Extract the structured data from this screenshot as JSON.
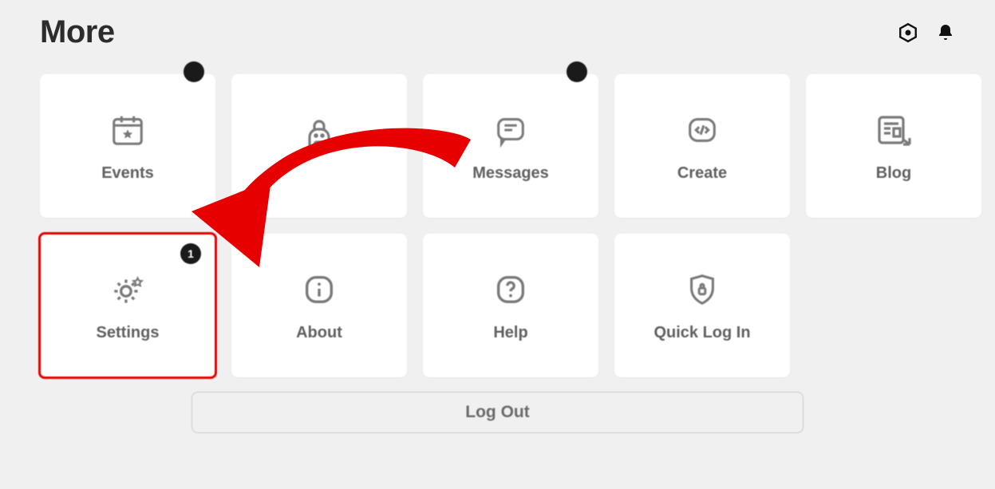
{
  "header": {
    "title": "More"
  },
  "tiles": {
    "events": {
      "label": "Events",
      "badge": ""
    },
    "inventory": {
      "label": "",
      "badge": ""
    },
    "messages": {
      "label": "Messages",
      "badge": ""
    },
    "create": {
      "label": "Create"
    },
    "blog": {
      "label": "Blog"
    },
    "settings": {
      "label": "Settings",
      "badge": "1"
    },
    "about": {
      "label": "About"
    },
    "help": {
      "label": "Help"
    },
    "quicklogin": {
      "label": "Quick Log In"
    }
  },
  "logout": {
    "label": "Log Out"
  },
  "annotation": {
    "highlight_tile": "settings",
    "arrow_points_to": "settings",
    "arrow_color": "#e60000"
  }
}
